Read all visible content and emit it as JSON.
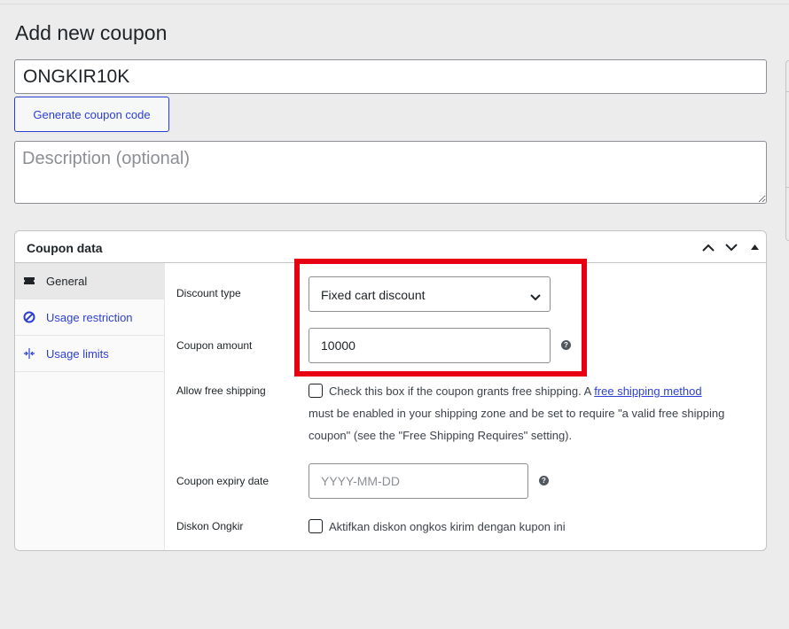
{
  "page": {
    "heading": "Add new coupon",
    "coupon_code": "ONGKIR10K",
    "generate_button": "Generate coupon code",
    "description_placeholder": "Description (optional)"
  },
  "coupon_data": {
    "title": "Coupon data",
    "tabs": [
      {
        "label": "General",
        "icon": "ticket-icon",
        "active": true
      },
      {
        "label": "Usage restriction",
        "icon": "blocked-icon",
        "active": false
      },
      {
        "label": "Usage limits",
        "icon": "limits-icon",
        "active": false
      }
    ],
    "fields": {
      "discount_type": {
        "label": "Discount type",
        "value": "Fixed cart discount"
      },
      "coupon_amount": {
        "label": "Coupon amount",
        "value": "10000"
      },
      "free_shipping": {
        "label": "Allow free shipping",
        "text_before": "Check this box if the coupon grants free shipping. A ",
        "link": "free shipping method",
        "text_after_line1": "must be enabled in your shipping zone and be set to require \"a valid free shipping",
        "text_after_line2": "coupon\" (see the \"Free Shipping Requires\" setting).",
        "checked": false
      },
      "expiry_date": {
        "label": "Coupon expiry date",
        "placeholder": "YYYY-MM-DD"
      },
      "diskon_ongkir": {
        "label": "Diskon Ongkir",
        "text": "Aktifkan diskon ongkos kirim dengan kupon ini",
        "checked": false
      }
    },
    "help_glyph": "?"
  },
  "colors": {
    "accent": "#2c3fd4",
    "highlight_box": "#e60012",
    "background": "#ececec"
  }
}
